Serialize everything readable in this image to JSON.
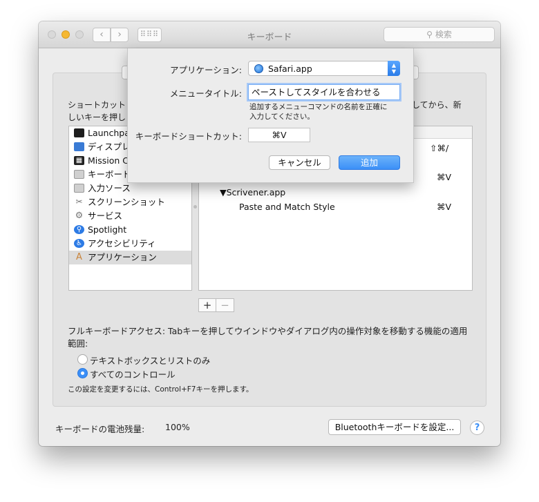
{
  "window": {
    "title": "キーボード",
    "search_placeholder": "検索"
  },
  "intro": {
    "line1": "ショートカット",
    "line2": "しいキーを押し",
    "right": "してから、新"
  },
  "categories": [
    {
      "label": "Launchpad",
      "icon": "launchpad-icon",
      "color": "#1e1e1e"
    },
    {
      "label": "ディスプレイ",
      "icon": "display-icon",
      "color": "#3a7bd5"
    },
    {
      "label": "Mission Control",
      "icon": "mission-control-icon",
      "color": "#222222"
    },
    {
      "label": "キーボード",
      "icon": "keyboard-icon",
      "color": "#d0d0d0"
    },
    {
      "label": "入力ソース",
      "icon": "input-source-icon",
      "color": "#d0d0d0"
    },
    {
      "label": "スクリーンショット",
      "icon": "screenshot-icon",
      "color": "#9a9a9a"
    },
    {
      "label": "サービス",
      "icon": "gear-icon",
      "color": "#8c8c8c"
    },
    {
      "label": "Spotlight",
      "icon": "spotlight-icon",
      "color": "#2d7be5"
    },
    {
      "label": "アクセシビリティ",
      "icon": "accessibility-icon",
      "color": "#2d7be5"
    },
    {
      "label": "アプリケーション",
      "icon": "application-icon",
      "color": "#c9833a"
    }
  ],
  "shortcuts": {
    "row1_key": "⇧⌘/",
    "row2_key": "⌘V",
    "app_group": "▼Scrivener.app",
    "item": "Paste and Match Style",
    "item_key": "⌘V"
  },
  "controls": {
    "plus": "+",
    "minus": "−"
  },
  "full_keyboard_access": {
    "text": "フルキーボードアクセス: Tabキーを押してウインドウやダイアログ内の操作対象を移動する機能の適用範囲:",
    "options": [
      "テキストボックスとリストのみ",
      "すべてのコントロール"
    ],
    "selected": 1,
    "note": "この設定を変更するには、Control+F7キーを押します。"
  },
  "footer": {
    "battery_label": "キーボードの電池残量:",
    "battery_value": "100%",
    "bluetooth_button": "Bluetoothキーボードを設定...",
    "help": "?"
  },
  "sheet": {
    "app_label": "アプリケーション:",
    "app_value": "Safari.app",
    "menu_title_label": "メニュータイトル:",
    "menu_title_value": "ペーストしてスタイルを合わせる",
    "hint": "追加するメニューコマンドの名前を正確に入力してください。",
    "shortcut_label": "キーボードショートカット:",
    "shortcut_value": "⌘V",
    "cancel": "キャンセル",
    "add": "追加"
  }
}
